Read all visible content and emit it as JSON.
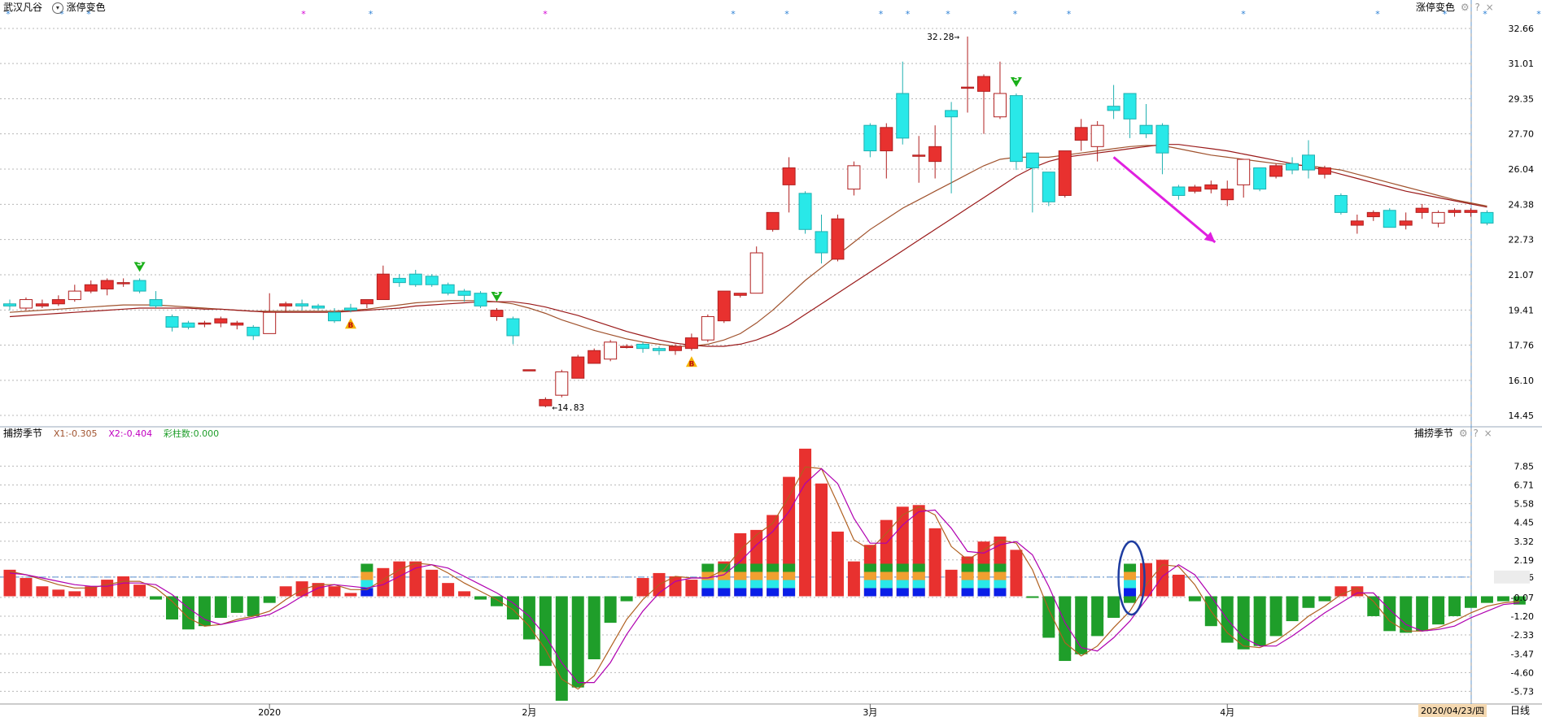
{
  "header": {
    "stock_name": "武汉凡谷",
    "indicator_name": "涨停变色",
    "right_indicator_name": "涨停变色"
  },
  "sub_header": {
    "indicator_name": "捕捞季节",
    "x1_label": "X1:-0.305",
    "x2_label": "X2:-0.404",
    "color_bar_label": "彩柱数:0.000",
    "right_indicator_name": "捕捞季节"
  },
  "icons": {
    "dropdown": "chevron-down-icon",
    "settings": "gear-icon",
    "help": "question-icon",
    "close": "close-icon"
  },
  "controls": {
    "help": "?",
    "close": "×",
    "settings": "⚙"
  },
  "colors": {
    "up": "#e8312f",
    "down": "#29e8e8",
    "ma_fast": "#a0522d",
    "ma_slow": "#9a1a1a",
    "macd_up": "#e8312f",
    "macd_down": "#1f9e2a",
    "band_green": "#1f9e2a",
    "band_orange": "#f0a030",
    "band_cyan": "#29e8e8",
    "band_blue": "#0a1ee8",
    "marker": "#d400d4",
    "highlight_ellipse": "#1e3ca0",
    "arrow": "#e020e0"
  },
  "footer": {
    "date_label": "2020/04/23/四",
    "period_button": "日线"
  },
  "chart_data": [
    {
      "type": "candlestick",
      "title": "",
      "ylim": [
        14.45,
        32.66
      ],
      "y_ticks": [
        "32.66",
        "31.01",
        "29.35",
        "27.70",
        "26.04",
        "24.38",
        "22.73",
        "21.07",
        "19.41",
        "17.76",
        "16.10",
        "14.45"
      ],
      "annotations": {
        "high_label": "32.28",
        "low_label": "14.83"
      },
      "markers": [
        {
          "label": "S",
          "index": 8
        },
        {
          "label": "B",
          "index": 21
        },
        {
          "label": "S",
          "index": 30
        },
        {
          "label": "B",
          "index": 42
        },
        {
          "label": "S",
          "index": 62
        }
      ],
      "x_labels": [
        {
          "text": "2020",
          "index": 16
        },
        {
          "text": "2月",
          "index": 32
        },
        {
          "text": "3月",
          "index": 53
        },
        {
          "text": "4月",
          "index": 75
        }
      ],
      "candles": [
        [
          19.7,
          19.6,
          19.9,
          19.4
        ],
        [
          19.5,
          19.9,
          20.0,
          19.4
        ],
        [
          19.6,
          19.7,
          19.9,
          19.5
        ],
        [
          19.7,
          19.9,
          20.1,
          19.6
        ],
        [
          19.9,
          20.3,
          20.6,
          19.8
        ],
        [
          20.3,
          20.6,
          20.8,
          20.2
        ],
        [
          20.4,
          20.8,
          20.9,
          20.1
        ],
        [
          20.7,
          20.7,
          20.9,
          20.5
        ],
        [
          20.8,
          20.3,
          20.9,
          20.2
        ],
        [
          19.9,
          19.6,
          20.3,
          19.5
        ],
        [
          19.1,
          18.6,
          19.2,
          18.4
        ],
        [
          18.8,
          18.6,
          18.9,
          18.5
        ],
        [
          18.8,
          18.8,
          18.9,
          18.6
        ],
        [
          18.8,
          19.0,
          19.1,
          18.6
        ],
        [
          18.7,
          18.8,
          18.9,
          18.5
        ],
        [
          18.6,
          18.2,
          18.7,
          18.0
        ],
        [
          18.3,
          19.3,
          20.2,
          18.3
        ],
        [
          19.6,
          19.7,
          19.8,
          19.3
        ],
        [
          19.7,
          19.6,
          19.9,
          19.4
        ],
        [
          19.6,
          19.5,
          19.7,
          19.4
        ],
        [
          19.3,
          18.9,
          19.5,
          18.8
        ],
        [
          19.5,
          19.4,
          19.7,
          19.3
        ],
        [
          19.7,
          19.9,
          19.9,
          19.5
        ],
        [
          19.9,
          21.1,
          21.5,
          19.9
        ],
        [
          20.9,
          20.7,
          21.1,
          20.5
        ],
        [
          21.1,
          20.6,
          21.3,
          20.5
        ],
        [
          21.0,
          20.6,
          21.1,
          20.5
        ],
        [
          20.6,
          20.2,
          20.7,
          20.1
        ],
        [
          20.3,
          20.1,
          20.4,
          19.8
        ],
        [
          20.2,
          19.6,
          20.3,
          19.5
        ],
        [
          19.1,
          19.4,
          19.5,
          18.9
        ],
        [
          19.0,
          18.2,
          19.1,
          17.8
        ],
        [
          16.6,
          16.6,
          16.6,
          16.6
        ],
        [
          14.9,
          15.2,
          15.3,
          14.83
        ],
        [
          15.4,
          16.5,
          16.6,
          15.3
        ],
        [
          16.2,
          17.2,
          17.3,
          16.2
        ],
        [
          16.9,
          17.5,
          17.6,
          16.9
        ],
        [
          17.1,
          17.9,
          18.0,
          17.0
        ],
        [
          17.7,
          17.7,
          17.8,
          17.6
        ],
        [
          17.8,
          17.6,
          17.9,
          17.4
        ],
        [
          17.6,
          17.5,
          17.7,
          17.3
        ],
        [
          17.5,
          17.7,
          17.8,
          17.3
        ],
        [
          17.6,
          18.1,
          18.3,
          17.5
        ],
        [
          18.0,
          19.1,
          19.2,
          17.9
        ],
        [
          18.9,
          20.3,
          20.3,
          18.8
        ],
        [
          20.1,
          20.2,
          20.2,
          20.0
        ],
        [
          20.2,
          22.1,
          22.4,
          20.2
        ],
        [
          23.2,
          24.0,
          24.0,
          23.1
        ],
        [
          25.3,
          26.1,
          26.6,
          24.0
        ],
        [
          24.9,
          23.2,
          25.0,
          23.0
        ],
        [
          23.1,
          22.1,
          23.9,
          21.6
        ],
        [
          21.8,
          23.7,
          23.9,
          21.7
        ],
        [
          25.1,
          26.2,
          26.4,
          24.8
        ],
        [
          28.1,
          26.9,
          28.2,
          26.6
        ],
        [
          26.9,
          28.0,
          28.2,
          25.6
        ],
        [
          29.6,
          27.5,
          31.1,
          27.2
        ],
        [
          26.7,
          26.7,
          27.6,
          25.4
        ],
        [
          26.4,
          27.1,
          28.1,
          25.6
        ],
        [
          28.8,
          28.5,
          29.2,
          24.9
        ],
        [
          29.9,
          29.9,
          32.28,
          28.7
        ],
        [
          29.7,
          30.4,
          30.5,
          27.7
        ],
        [
          28.5,
          29.6,
          31.1,
          28.4
        ],
        [
          29.5,
          26.4,
          29.6,
          26.0
        ],
        [
          26.8,
          26.1,
          26.8,
          24.0
        ],
        [
          25.9,
          24.5,
          25.9,
          24.3
        ],
        [
          24.8,
          26.9,
          26.9,
          24.7
        ],
        [
          27.4,
          28.0,
          28.4,
          26.9
        ],
        [
          27.1,
          28.1,
          28.3,
          26.4
        ],
        [
          29.0,
          28.8,
          30.0,
          28.4
        ],
        [
          29.6,
          28.4,
          29.6,
          27.5
        ],
        [
          28.1,
          27.7,
          29.1,
          27.5
        ],
        [
          28.1,
          26.8,
          28.2,
          25.8
        ],
        [
          25.2,
          24.8,
          25.3,
          24.6
        ],
        [
          25.0,
          25.2,
          25.3,
          24.9
        ],
        [
          25.1,
          25.3,
          25.5,
          24.9
        ],
        [
          24.6,
          25.1,
          25.5,
          24.3
        ],
        [
          25.3,
          26.5,
          26.5,
          24.7
        ],
        [
          26.1,
          25.1,
          26.1,
          25.0
        ],
        [
          25.7,
          26.2,
          26.3,
          25.6
        ],
        [
          26.3,
          26.0,
          26.6,
          25.8
        ],
        [
          26.7,
          26.0,
          27.4,
          25.6
        ],
        [
          25.8,
          26.1,
          26.2,
          25.6
        ],
        [
          24.8,
          24.0,
          24.9,
          23.9
        ],
        [
          23.4,
          23.6,
          23.9,
          23.0
        ],
        [
          23.8,
          24.0,
          24.1,
          23.6
        ],
        [
          24.1,
          23.3,
          24.2,
          23.3
        ],
        [
          23.4,
          23.6,
          24.0,
          23.2
        ],
        [
          24.0,
          24.2,
          24.4,
          23.7
        ],
        [
          23.5,
          24.0,
          24.1,
          23.3
        ],
        [
          24.0,
          24.1,
          24.2,
          23.8
        ],
        [
          24.0,
          24.1,
          24.2,
          23.8
        ],
        [
          24.0,
          23.5,
          24.1,
          23.4
        ]
      ],
      "ma_fast": [
        19.3,
        19.35,
        19.4,
        19.45,
        19.5,
        19.55,
        19.6,
        19.65,
        19.65,
        19.65,
        19.6,
        19.55,
        19.5,
        19.45,
        19.4,
        19.35,
        19.35,
        19.35,
        19.35,
        19.35,
        19.35,
        19.4,
        19.45,
        19.55,
        19.65,
        19.75,
        19.8,
        19.85,
        19.85,
        19.85,
        19.8,
        19.7,
        19.5,
        19.25,
        18.95,
        18.7,
        18.45,
        18.25,
        18.05,
        17.9,
        17.8,
        17.7,
        17.7,
        17.8,
        18.0,
        18.3,
        18.8,
        19.4,
        20.1,
        20.8,
        21.4,
        22.0,
        22.6,
        23.2,
        23.7,
        24.2,
        24.6,
        25.0,
        25.4,
        25.8,
        26.2,
        26.5,
        26.6,
        26.6,
        26.6,
        26.7,
        26.8,
        26.9,
        27.0,
        27.1,
        27.15,
        27.15,
        27.0,
        26.85,
        26.7,
        26.6,
        26.5,
        26.4,
        26.3,
        26.25,
        26.2,
        26.1,
        26.0,
        25.8,
        25.6,
        25.4,
        25.2,
        25.0,
        24.8,
        24.6,
        24.45,
        24.3
      ],
      "ma_slow": [
        19.1,
        19.15,
        19.2,
        19.25,
        19.3,
        19.35,
        19.4,
        19.45,
        19.5,
        19.5,
        19.5,
        19.5,
        19.45,
        19.45,
        19.4,
        19.35,
        19.3,
        19.3,
        19.3,
        19.3,
        19.3,
        19.35,
        19.4,
        19.45,
        19.5,
        19.6,
        19.65,
        19.7,
        19.75,
        19.8,
        19.8,
        19.8,
        19.7,
        19.55,
        19.35,
        19.15,
        18.9,
        18.65,
        18.4,
        18.2,
        18.0,
        17.85,
        17.75,
        17.7,
        17.7,
        17.8,
        18.0,
        18.3,
        18.7,
        19.2,
        19.7,
        20.2,
        20.7,
        21.2,
        21.7,
        22.2,
        22.7,
        23.2,
        23.7,
        24.2,
        24.7,
        25.2,
        25.7,
        26.1,
        26.4,
        26.6,
        26.7,
        26.8,
        26.9,
        27.0,
        27.1,
        27.2,
        27.2,
        27.1,
        27.0,
        26.9,
        26.75,
        26.6,
        26.45,
        26.3,
        26.15,
        26.0,
        25.8,
        25.6,
        25.4,
        25.2,
        25.0,
        24.85,
        24.7,
        24.55,
        24.4,
        24.25
      ]
    },
    {
      "type": "bar",
      "title": "捕捞季节",
      "ylim": [
        -6.3,
        8.7
      ],
      "y_ticks": [
        "7.85",
        "6.71",
        "5.58",
        "4.45",
        "3.32",
        "2.19",
        "1.16",
        "-0.07",
        "-1.20",
        "-2.33",
        "-3.47",
        "-4.60",
        "-5.73"
      ],
      "reference_line": 1.16,
      "values": [
        1.6,
        1.1,
        0.6,
        0.4,
        0.3,
        0.6,
        1.0,
        1.2,
        0.7,
        -0.2,
        -1.4,
        -2.0,
        -1.8,
        -1.3,
        -1.0,
        -1.2,
        -0.4,
        0.6,
        0.9,
        0.8,
        0.6,
        0.2,
        0.5,
        1.7,
        2.1,
        2.1,
        1.6,
        0.8,
        0.3,
        -0.2,
        -0.6,
        -1.4,
        -2.6,
        -4.2,
        -6.3,
        -5.5,
        -3.8,
        -1.6,
        -0.3,
        1.1,
        1.4,
        1.2,
        1.0,
        1.1,
        2.1,
        3.8,
        4.0,
        4.9,
        7.2,
        8.9,
        6.8,
        3.9,
        2.1,
        3.1,
        4.6,
        5.4,
        5.5,
        4.1,
        1.6,
        2.4,
        3.3,
        3.6,
        2.8,
        -0.1,
        -2.5,
        -3.9,
        -3.5,
        -2.4,
        -1.3,
        -0.4,
        2.0,
        2.2,
        1.3,
        -0.3,
        -1.8,
        -2.8,
        -3.2,
        -3.0,
        -2.4,
        -1.5,
        -0.7,
        -0.3,
        0.6,
        0.6,
        -1.2,
        -2.1,
        -2.2,
        -2.1,
        -1.7,
        -1.2,
        -0.7,
        -0.4,
        -0.3,
        -0.5
      ],
      "x1": [
        1.5,
        1.3,
        1.0,
        0.7,
        0.5,
        0.5,
        0.7,
        0.9,
        0.9,
        0.5,
        -0.3,
        -1.3,
        -1.8,
        -1.7,
        -1.4,
        -1.2,
        -0.9,
        -0.2,
        0.4,
        0.7,
        0.7,
        0.4,
        0.4,
        1.0,
        1.6,
        2.0,
        1.9,
        1.4,
        0.8,
        0.3,
        -0.2,
        -0.8,
        -1.8,
        -3.2,
        -5.0,
        -5.6,
        -4.8,
        -3.1,
        -1.4,
        -0.2,
        0.7,
        1.2,
        1.1,
        1.1,
        1.6,
        2.8,
        3.7,
        4.4,
        6.0,
        7.8,
        7.7,
        5.6,
        3.4,
        2.8,
        3.8,
        4.9,
        5.4,
        4.9,
        3.0,
        2.2,
        2.8,
        3.4,
        3.2,
        1.6,
        -0.8,
        -2.8,
        -3.6,
        -3.0,
        -1.9,
        -0.9,
        0.7,
        1.9,
        1.8,
        0.7,
        -0.9,
        -2.2,
        -3.0,
        -3.1,
        -2.7,
        -2.0,
        -1.2,
        -0.6,
        0.1,
        0.5,
        -0.3,
        -1.5,
        -2.1,
        -2.1,
        -1.9,
        -1.5,
        -1.0,
        -0.6,
        -0.4,
        -0.3
      ],
      "x2": [
        1.4,
        1.3,
        1.1,
        0.9,
        0.7,
        0.6,
        0.6,
        0.8,
        0.8,
        0.7,
        0.1,
        -0.7,
        -1.4,
        -1.7,
        -1.5,
        -1.3,
        -1.1,
        -0.6,
        0.0,
        0.5,
        0.7,
        0.6,
        0.5,
        0.7,
        1.2,
        1.7,
        1.9,
        1.7,
        1.2,
        0.7,
        0.2,
        -0.4,
        -1.2,
        -2.4,
        -4.0,
        -5.2,
        -5.2,
        -4.0,
        -2.3,
        -0.9,
        0.2,
        0.9,
        1.1,
        1.1,
        1.3,
        2.1,
        3.1,
        3.9,
        5.1,
        6.8,
        7.7,
        6.8,
        4.7,
        3.2,
        3.2,
        4.3,
        5.1,
        5.2,
        4.1,
        2.7,
        2.6,
        3.1,
        3.3,
        2.5,
        0.6,
        -1.6,
        -3.1,
        -3.3,
        -2.5,
        -1.5,
        -0.2,
        1.2,
        1.9,
        1.3,
        0.0,
        -1.4,
        -2.5,
        -3.0,
        -3.0,
        -2.4,
        -1.7,
        -1.0,
        -0.4,
        0.2,
        0.2,
        -0.8,
        -1.7,
        -2.1,
        -2.0,
        -1.8,
        -1.3,
        -0.9,
        -0.5,
        -0.4
      ],
      "color_band_indices": [
        22,
        43,
        44,
        45,
        46,
        47,
        48,
        53,
        54,
        55,
        56,
        59,
        60,
        61,
        69
      ]
    }
  ]
}
